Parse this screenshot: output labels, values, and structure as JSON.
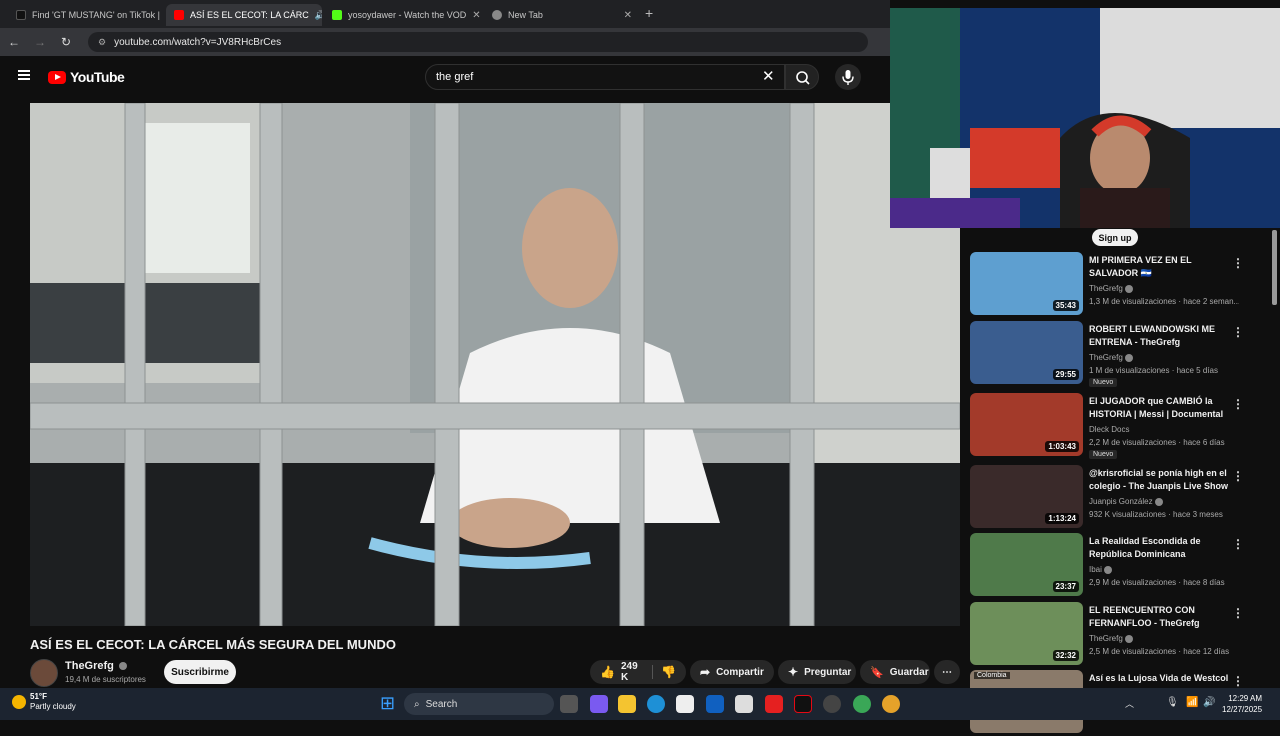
{
  "browser": {
    "tabs": [
      {
        "label": "Find 'GT MUSTANG' on TikTok |",
        "active": false
      },
      {
        "label": "ASÍ ES EL CECOT: LA CÁRC",
        "active": true
      },
      {
        "label": "yosoydawer - Watch the VOD",
        "active": false
      },
      {
        "label": "New Tab",
        "active": false
      }
    ],
    "url": "youtube.com/watch?v=JV8RHcBrCes"
  },
  "youtube": {
    "logo_text": "YouTube",
    "search_value": "the gref"
  },
  "video": {
    "title": "ASÍ ES EL CECOT: LA CÁRCEL MÁS SEGURA DEL MUNDO",
    "channel": "TheGrefg",
    "subscribers": "19,4 M de suscriptores",
    "subscribe_label": "Suscribirme",
    "likes": "249 K",
    "share_label": "Compartir",
    "ask_label": "Preguntar",
    "save_label": "Guardar"
  },
  "overlay": {
    "signup_label": "Sign up"
  },
  "recommendations": [
    {
      "title": "MI PRIMERA VEZ EN EL SALVADOR 🇸🇻",
      "channel": "TheGrefg",
      "verified": true,
      "meta": "1,3 M de visualizaciones · hace 2 seman...",
      "duration": "35:43",
      "badge": "",
      "thumb_color": "#5e9fd0"
    },
    {
      "title": "ROBERT LEWANDOWSKI ME ENTRENA - TheGrefg",
      "channel": "TheGrefg",
      "verified": true,
      "meta": "1 M de visualizaciones · hace 5 días",
      "duration": "29:55",
      "badge": "Nuevo",
      "thumb_color": "#3a5d8f"
    },
    {
      "title": "El JUGADOR que CAMBIÓ la HISTORIA | Messi | Documental",
      "channel": "Dleck Docs",
      "verified": false,
      "meta": "2,2 M de visualizaciones · hace 6 días",
      "duration": "1:03:43",
      "badge": "Nuevo",
      "thumb_color": "#a33a2a"
    },
    {
      "title": "@krisroficial se ponía high en el colegio - The Juanpis Live Show",
      "channel": "Juanpis González",
      "verified": true,
      "meta": "932 K visualizaciones · hace 3 meses",
      "duration": "1:13:24",
      "badge": "",
      "thumb_color": "#3a2a2a"
    },
    {
      "title": "La Realidad Escondida de República Dominicana",
      "channel": "Ibai",
      "verified": true,
      "meta": "2,9 M de visualizaciones · hace 8 días",
      "duration": "23:37",
      "badge": "",
      "thumb_color": "#4f7a4a"
    },
    {
      "title": "EL REENCUENTRO CON FERNANFLOO - TheGrefg",
      "channel": "TheGrefg",
      "verified": true,
      "meta": "2,5 M de visualizaciones · hace 12 días",
      "duration": "32:32",
      "badge": "",
      "thumb_color": "#6d8f5a"
    },
    {
      "title": "Así es la Lujosa Vida de Westcol",
      "channel": "",
      "verified": false,
      "meta": "",
      "duration": "",
      "badge": "",
      "thumb_color": "#8a7a6a",
      "thumb_tag": "Colombia"
    }
  ],
  "taskbar": {
    "temperature": "51°F",
    "weather": "Partly cloudy",
    "search_label": "Search",
    "time": "12:29 AM",
    "date": "12/27/2025"
  }
}
